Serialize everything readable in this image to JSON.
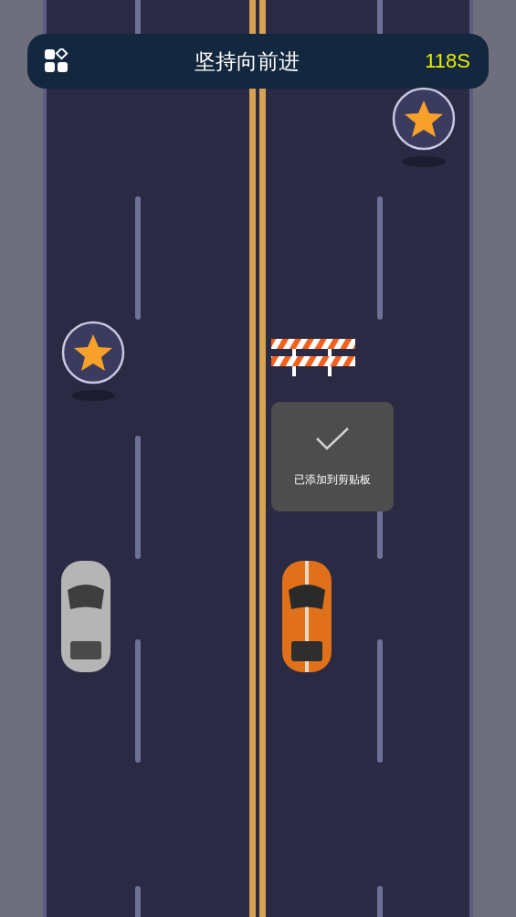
{
  "header": {
    "title": "坚持向前进",
    "timer": "118S"
  },
  "toast": {
    "message": "已添加到剪贴板"
  }
}
